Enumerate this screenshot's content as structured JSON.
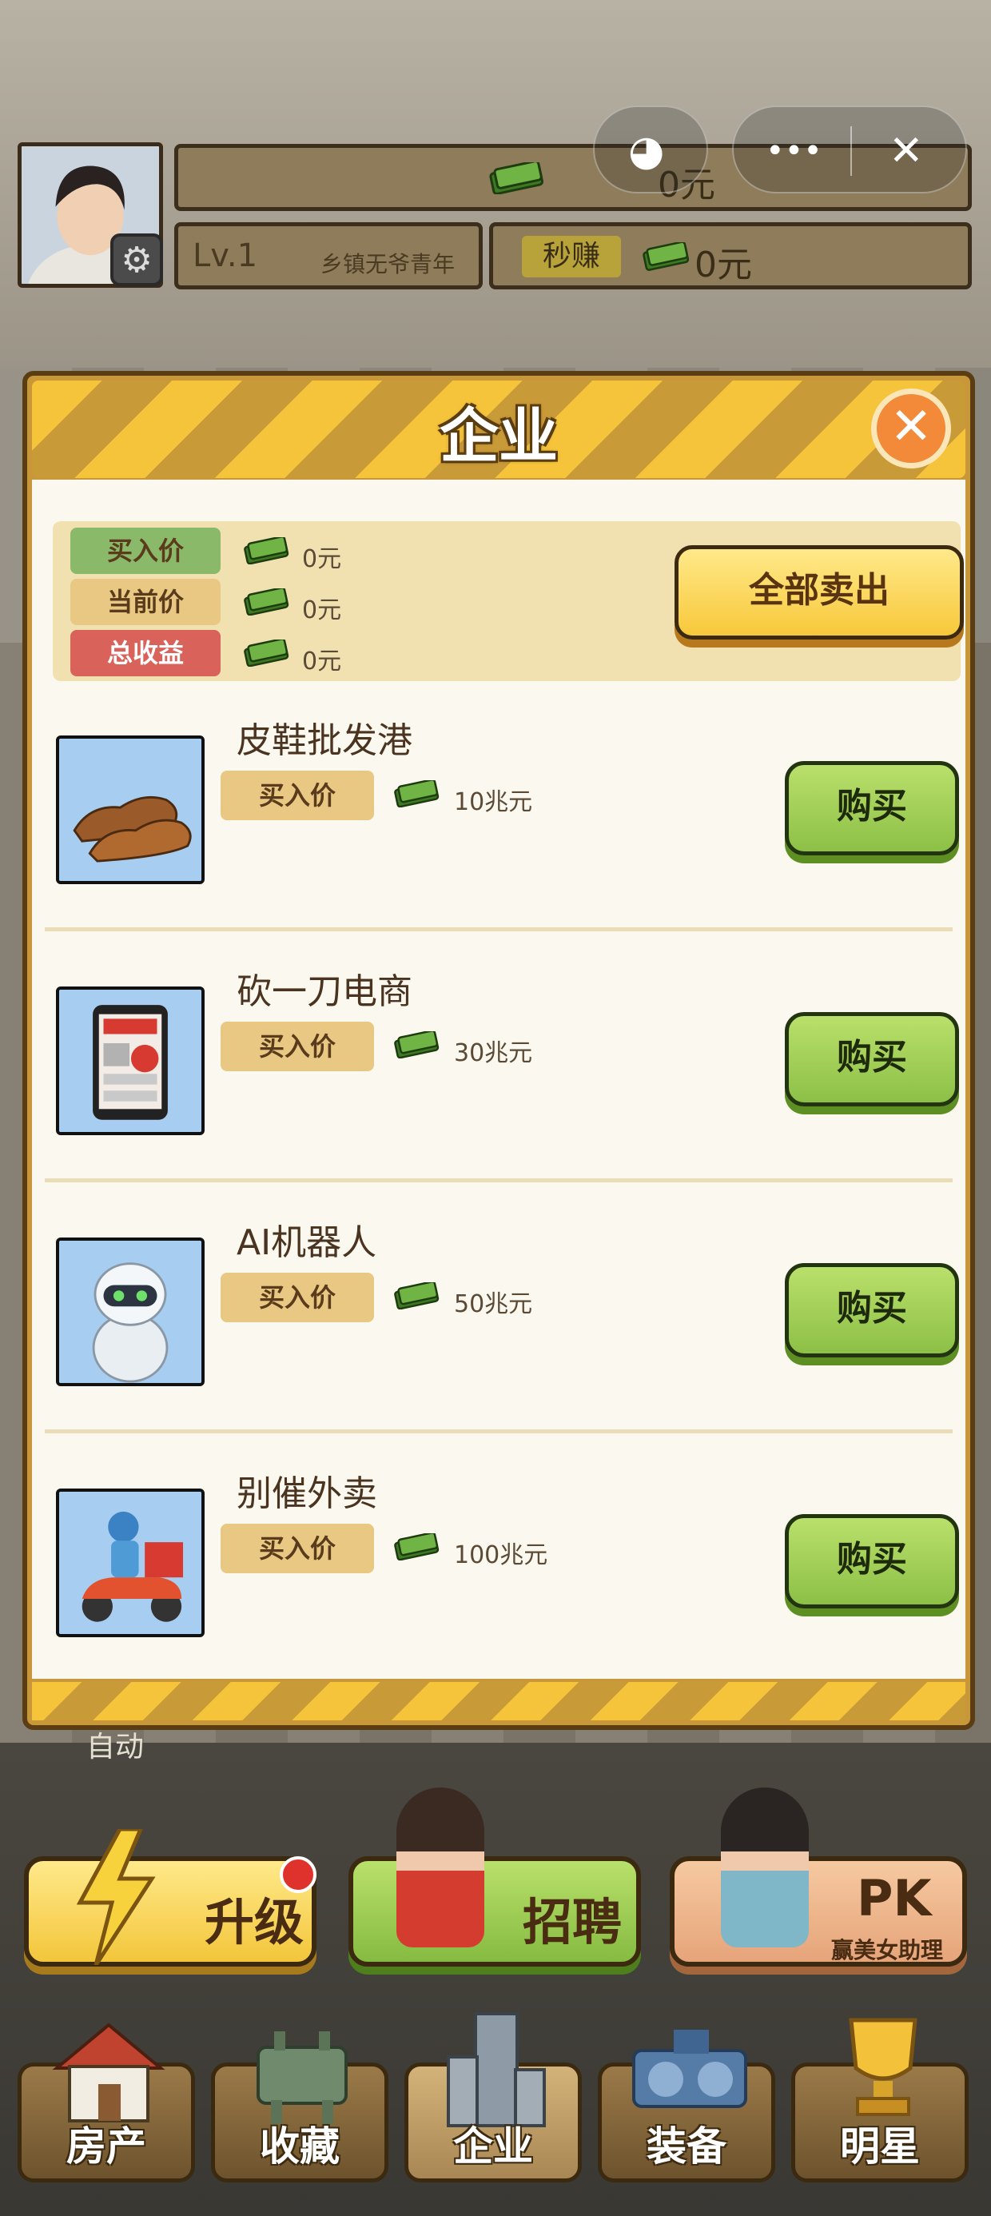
{
  "hud": {
    "money": "0元",
    "level": "Lv.1",
    "level_title": "乡镇无爷青年",
    "earn_tag": "秒赚",
    "earn_amount": "0元"
  },
  "modal": {
    "title": "企业",
    "summary": {
      "buy_label": "买入价",
      "buy_value": "0元",
      "current_label": "当前价",
      "current_value": "0元",
      "profit_label": "总收益",
      "profit_value": "0元",
      "sell_all": "全部卖出"
    },
    "items": [
      {
        "name": "皮鞋批发港",
        "price_label": "买入价",
        "price": "10兆元",
        "buy": "购买",
        "icon": "shoe-icon"
      },
      {
        "name": "砍一刀电商",
        "price_label": "买入价",
        "price": "30兆元",
        "buy": "购买",
        "icon": "tablet-icon"
      },
      {
        "name": "AI机器人",
        "price_label": "买入价",
        "price": "50兆元",
        "buy": "购买",
        "icon": "robot-icon"
      },
      {
        "name": "别催外卖",
        "price_label": "买入价",
        "price": "100兆元",
        "buy": "购买",
        "icon": "delivery-scooter-icon"
      }
    ]
  },
  "behind_label": "自动",
  "actions": {
    "upgrade": "升级",
    "hire": "招聘",
    "pk": "PK",
    "pk_sub": "赢美女助理"
  },
  "nav": [
    "房产",
    "收藏",
    "企业",
    "装备",
    "明星"
  ],
  "colors": {
    "stripe_yellow": "#f5c43a",
    "buy_green": "#8dc047",
    "sell_yellow": "#f8c83a",
    "profit_red": "#d9625a"
  }
}
